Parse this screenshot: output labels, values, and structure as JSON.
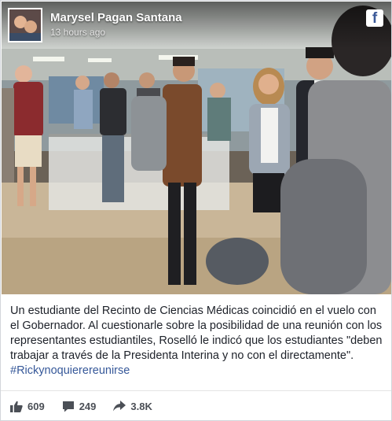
{
  "post": {
    "author": "Marysel Pagan Santana",
    "timestamp": "13 hours ago",
    "platform_icon": "facebook-icon",
    "caption": "Un estudiante del Recinto de Ciencias Médicas coincidió en el vuelo con el Gobernador. Al cuestionarle sobre la posibilidad de una reunión con los representantes estudiantiles, Roselló le indicó que los estudiantes \"deben trabajar a través de la Presidenta Interina y no con el directamente\".",
    "hashtag": "#Rickynoquierereunirse"
  },
  "stats": {
    "likes": "609",
    "comments": "249",
    "shares": "3.8K"
  },
  "colors": {
    "link": "#365899",
    "facebook": "#3b5998",
    "stat_text": "#4b4f56"
  }
}
